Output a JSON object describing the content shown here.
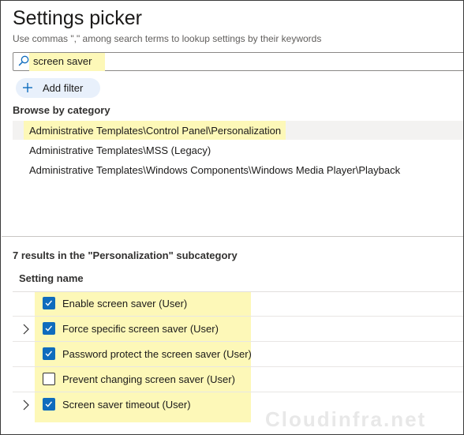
{
  "header": {
    "title": "Settings picker",
    "subtitle": "Use commas \",\" among search terms to lookup settings by their keywords"
  },
  "search": {
    "value": "screen saver",
    "icon": "search-icon"
  },
  "add_filter": {
    "label": "Add filter",
    "icon": "plus-icon"
  },
  "browse": {
    "label": "Browse by category",
    "categories": [
      {
        "label": "Administrative Templates\\Control Panel\\Personalization",
        "selected": true
      },
      {
        "label": "Administrative Templates\\MSS (Legacy)",
        "selected": false
      },
      {
        "label": "Administrative Templates\\Windows Components\\Windows Media Player\\Playback",
        "selected": false
      }
    ]
  },
  "results": {
    "summary": "7 results in the \"Personalization\" subcategory",
    "column_header": "Setting name",
    "rows": [
      {
        "label": "Enable screen saver (User)",
        "checked": true,
        "expandable": false
      },
      {
        "label": "Force specific screen saver (User)",
        "checked": true,
        "expandable": true
      },
      {
        "label": "Password protect the screen saver (User)",
        "checked": true,
        "expandable": false
      },
      {
        "label": "Prevent changing screen saver (User)",
        "checked": false,
        "expandable": false
      },
      {
        "label": "Screen saver timeout (User)",
        "checked": true,
        "expandable": true
      }
    ]
  },
  "watermark": "Cloudinfra.net",
  "colors": {
    "accent": "#0f6cbd",
    "highlight": "#fdf8b8",
    "selected_row": "#f3f2f1",
    "filter_bg": "#e8f0fb"
  }
}
